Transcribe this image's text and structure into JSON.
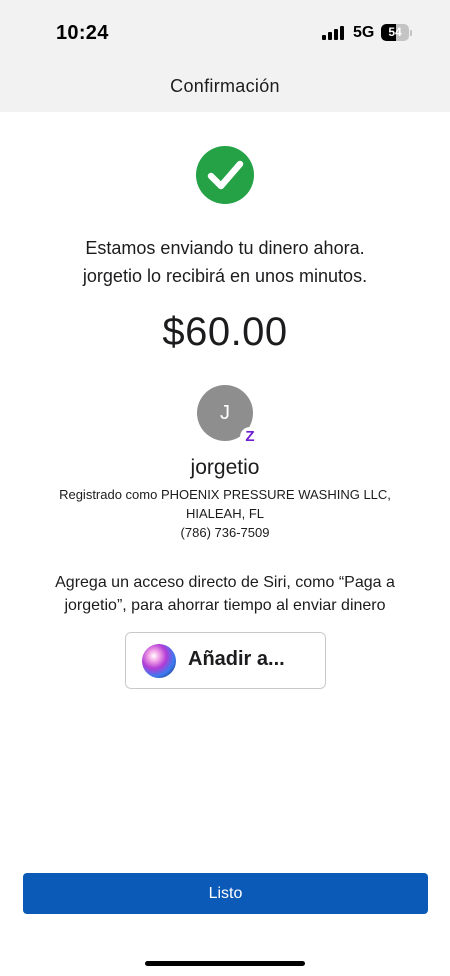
{
  "status_bar": {
    "time": "10:24",
    "network": "5G",
    "battery": "54",
    "battery_level_percent": 54
  },
  "header": {
    "title": "Confirmación"
  },
  "confirmation": {
    "icon": "checkmark-circle-icon",
    "message_line1": "Estamos enviando tu dinero ahora.",
    "message_line2": "jorgetio lo recibirá en unos minutos.",
    "amount": "$60.00"
  },
  "recipient": {
    "initial": "J",
    "badge": "Z",
    "name": "jorgetio",
    "registered_line1": "Registrado como PHOENIX PRESSURE WASHING LLC,",
    "registered_line2": "HIALEAH, FL",
    "phone": "(786) 736-7509"
  },
  "siri": {
    "text_line1": "Agrega un acceso directo de Siri, como “Paga a",
    "text_line2": "jorgetio”, para ahorrar tiempo al enviar dinero",
    "button_label": "Añadir a...",
    "icon": "siri-icon"
  },
  "actions": {
    "done_label": "Listo"
  },
  "colors": {
    "success_green": "#24a245",
    "primary_blue": "#0b5ab8",
    "zelle_purple": "#6d1ed4",
    "avatar_gray": "#8e8e8e"
  }
}
